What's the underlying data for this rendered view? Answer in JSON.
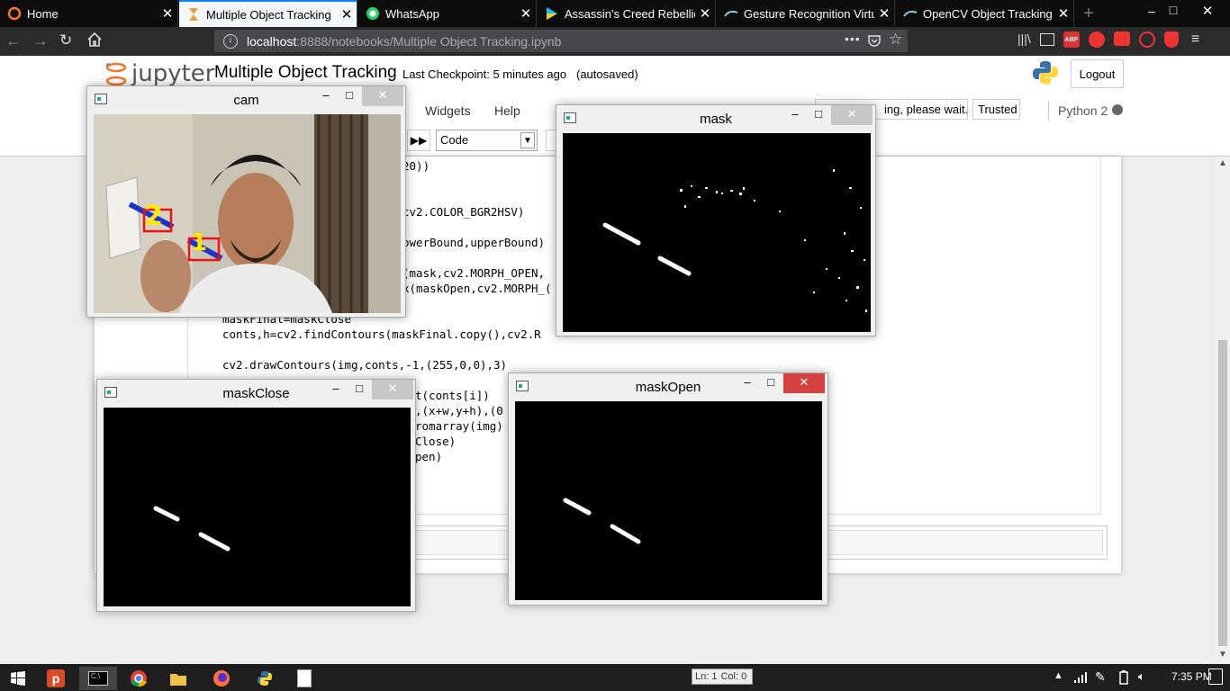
{
  "browser": {
    "tabs": [
      {
        "title": "Home",
        "icon": "jupyter-icon"
      },
      {
        "title": "Multiple Object Tracking",
        "icon": "hourglass-icon",
        "active": true
      },
      {
        "title": "WhatsApp",
        "icon": "whatsapp-icon"
      },
      {
        "title": "Assassin's Creed Rebellion",
        "icon": "play-store-icon"
      },
      {
        "title": "Gesture Recognition Virtu",
        "icon": "gesture-icon"
      },
      {
        "title": "OpenCV Object Tracking b",
        "icon": "opencv-icon"
      }
    ],
    "url_host": "localhost",
    "url_rest": ":8888/notebooks/Multiple Object Tracking.ipynb",
    "page_actions_icon": "•••"
  },
  "jupyter": {
    "logo_text": "jupyter",
    "notebook_title": "Multiple Object Tracking",
    "checkpoint": "Last Checkpoint: 5 minutes ago",
    "autosaved": "(autosaved)",
    "logout": "Logout",
    "menu": {
      "widgets": "Widgets",
      "help": "Help"
    },
    "status": "ing, please wait...",
    "trusted": "Trusted",
    "kernel": "Python 2",
    "cell_type": "Code"
  },
  "code_lines": [
    {
      "text": "20))"
    },
    {
      "text": "cv2.COLOR_BGR2HSV)"
    },
    {
      "text": "owerBound,upperBound)"
    },
    {
      "text": "(mask,cv2.MORPH_OPEN,"
    },
    {
      "text": "x(maskOpen,cv2.MORPH_("
    },
    {
      "text": "maskFinal=maskClose"
    },
    {
      "text": "conts,h=cv2.findContours(maskFinal.copy(),cv2.R"
    },
    {
      "text": "cv2.drawContours(img,conts,-1,(255,0,0),3)"
    },
    {
      "text": "t(conts[i])"
    },
    {
      "text": ",(x+w,y+h),(0"
    },
    {
      "text": "romarray(img)"
    },
    {
      "text": "Close)"
    },
    {
      "text": "pen)"
    }
  ],
  "windows": {
    "cam": {
      "title": "cam",
      "labels": [
        "2",
        "1"
      ]
    },
    "mask": {
      "title": "mask"
    },
    "maskClose": {
      "title": "maskClose"
    },
    "maskOpen": {
      "title": "maskOpen"
    },
    "minimize": "–",
    "maximize": "□",
    "close": "✕"
  },
  "taskbar": {
    "status_ln": "Ln: 1",
    "status_col": "Col: 0",
    "time": "7:35 PM"
  },
  "colors": {
    "tab_accent": "#0a84ff",
    "close_red": "#d24040",
    "jupyter_orange": "#f37726"
  }
}
